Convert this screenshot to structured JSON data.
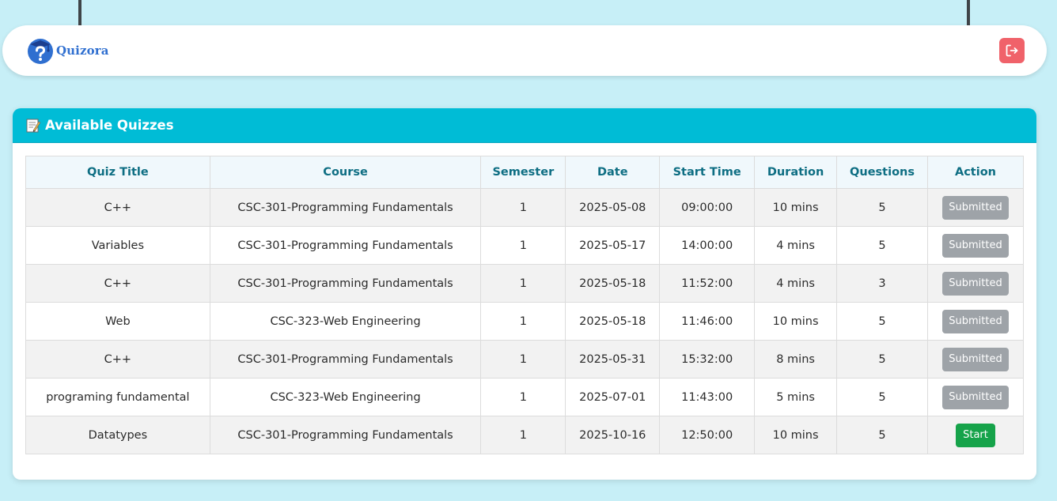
{
  "brand": {
    "name": "Quizora"
  },
  "card": {
    "title": "Available Quizzes"
  },
  "table": {
    "headers": [
      "Quiz Title",
      "Course",
      "Semester",
      "Date",
      "Start Time",
      "Duration",
      "Questions",
      "Action"
    ],
    "rows": [
      {
        "title": "C++",
        "course": "CSC-301-Programming Fundamentals",
        "semester": "1",
        "date": "2025-05-08",
        "start_time": "09:00:00",
        "duration": "10 mins",
        "questions": "5",
        "action": "Submitted"
      },
      {
        "title": "Variables",
        "course": "CSC-301-Programming Fundamentals",
        "semester": "1",
        "date": "2025-05-17",
        "start_time": "14:00:00",
        "duration": "4 mins",
        "questions": "5",
        "action": "Submitted"
      },
      {
        "title": "C++",
        "course": "CSC-301-Programming Fundamentals",
        "semester": "1",
        "date": "2025-05-18",
        "start_time": "11:52:00",
        "duration": "4 mins",
        "questions": "3",
        "action": "Submitted"
      },
      {
        "title": "Web",
        "course": "CSC-323-Web Engineering",
        "semester": "1",
        "date": "2025-05-18",
        "start_time": "11:46:00",
        "duration": "10 mins",
        "questions": "5",
        "action": "Submitted"
      },
      {
        "title": "C++",
        "course": "CSC-301-Programming Fundamentals",
        "semester": "1",
        "date": "2025-05-31",
        "start_time": "15:32:00",
        "duration": "8 mins",
        "questions": "5",
        "action": "Submitted"
      },
      {
        "title": "programing fundamental",
        "course": "CSC-323-Web Engineering",
        "semester": "1",
        "date": "2025-07-01",
        "start_time": "11:43:00",
        "duration": "5 mins",
        "questions": "5",
        "action": "Submitted"
      },
      {
        "title": "Datatypes",
        "course": "CSC-301-Programming Fundamentals",
        "semester": "1",
        "date": "2025-10-16",
        "start_time": "12:50:00",
        "duration": "10 mins",
        "questions": "5",
        "action": "Start"
      }
    ]
  },
  "colors": {
    "page_background": "#c7eff7",
    "header_accent": "#00bcd6",
    "header_text": "#0e6e83",
    "brand_blue": "#2f6fd0",
    "logout_red": "#f0626a",
    "submitted_gray": "#9ea3a8",
    "start_green": "#16a34a"
  },
  "icons": {
    "logo": "quiz-logo-icon",
    "logout": "logout-icon",
    "title": "memo-icon"
  }
}
